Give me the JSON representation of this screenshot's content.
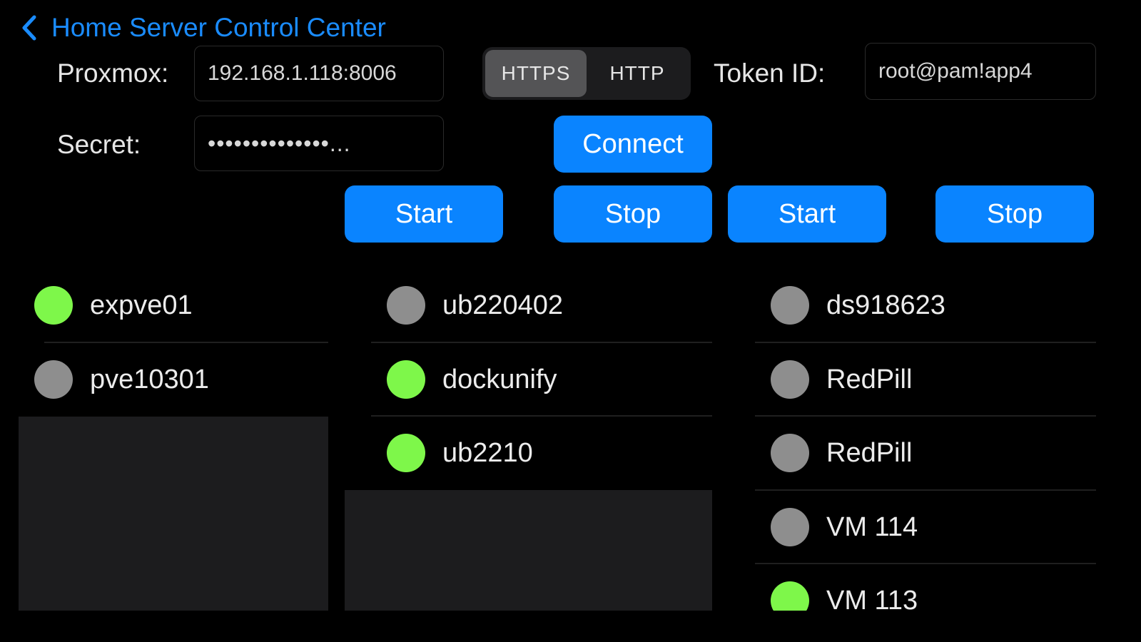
{
  "nav": {
    "back_title": "Home Server Control Center"
  },
  "form": {
    "proxmox_label": "Proxmox:",
    "proxmox_value": "192.168.1.118:8006",
    "protocol_options": [
      "HTTPS",
      "HTTP"
    ],
    "protocol_selected": "HTTPS",
    "token_label": "Token ID:",
    "token_value": "root@pam!app4",
    "secret_label": "Secret:",
    "secret_value": "••••••••••••••...",
    "connect_label": "Connect"
  },
  "actions": {
    "start_1": "Start",
    "stop_1": "Stop",
    "start_2": "Start",
    "stop_2": "Stop"
  },
  "colors": {
    "running": "#7ef74a",
    "stopped": "#8e8e8e",
    "accent": "#0a84ff"
  },
  "lists": {
    "nodes": [
      {
        "name": "expve01",
        "status": "running"
      },
      {
        "name": "pve10301",
        "status": "stopped"
      }
    ],
    "vms_a": [
      {
        "name": "ub220402",
        "status": "stopped"
      },
      {
        "name": "dockunify",
        "status": "running"
      },
      {
        "name": "ub2210",
        "status": "running"
      }
    ],
    "vms_b": [
      {
        "name": "ds918623",
        "status": "stopped"
      },
      {
        "name": "RedPill",
        "status": "stopped"
      },
      {
        "name": "RedPill",
        "status": "stopped"
      },
      {
        "name": "VM 114",
        "status": "stopped"
      },
      {
        "name": "VM 113",
        "status": "running"
      }
    ]
  }
}
